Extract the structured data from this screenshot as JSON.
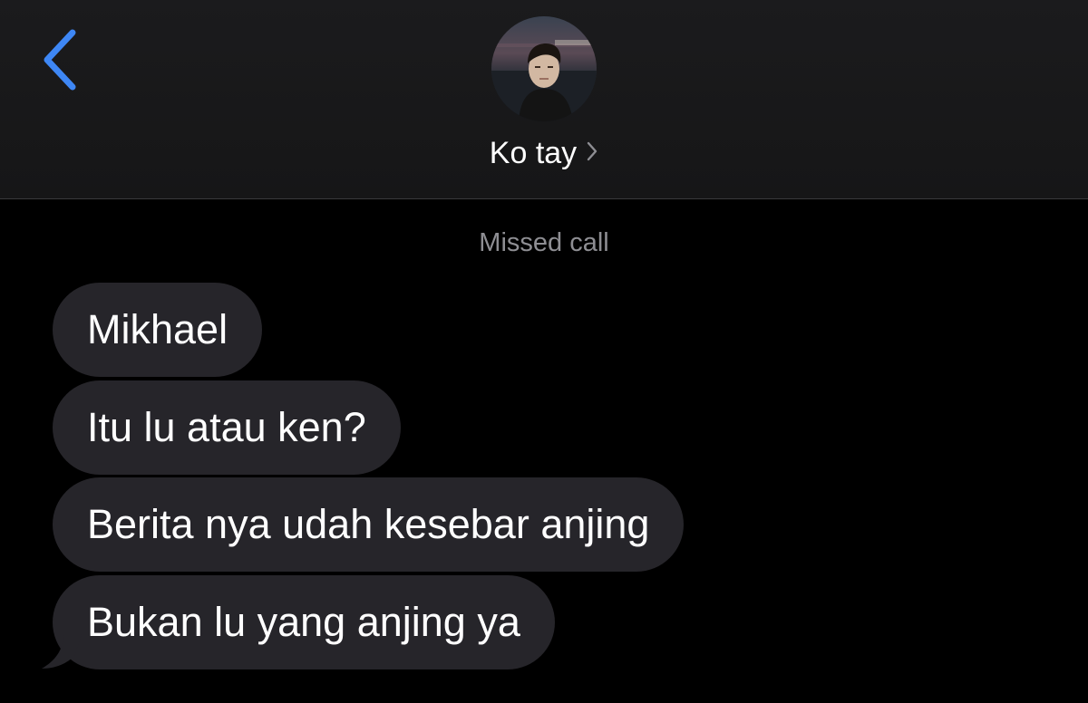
{
  "header": {
    "contact_name": "Ko tay",
    "back_icon": "chevron-left-icon",
    "details_icon": "chevron-right-icon",
    "accent_color": "#3e87f5"
  },
  "thread": {
    "status_text": "Missed call",
    "messages": [
      {
        "text": "Mikhael"
      },
      {
        "text": "Itu lu atau ken?"
      },
      {
        "text": "Berita nya udah kesebar anjing"
      },
      {
        "text": "Bukan lu yang anjing ya"
      }
    ],
    "bubble_color": "#26252a"
  }
}
